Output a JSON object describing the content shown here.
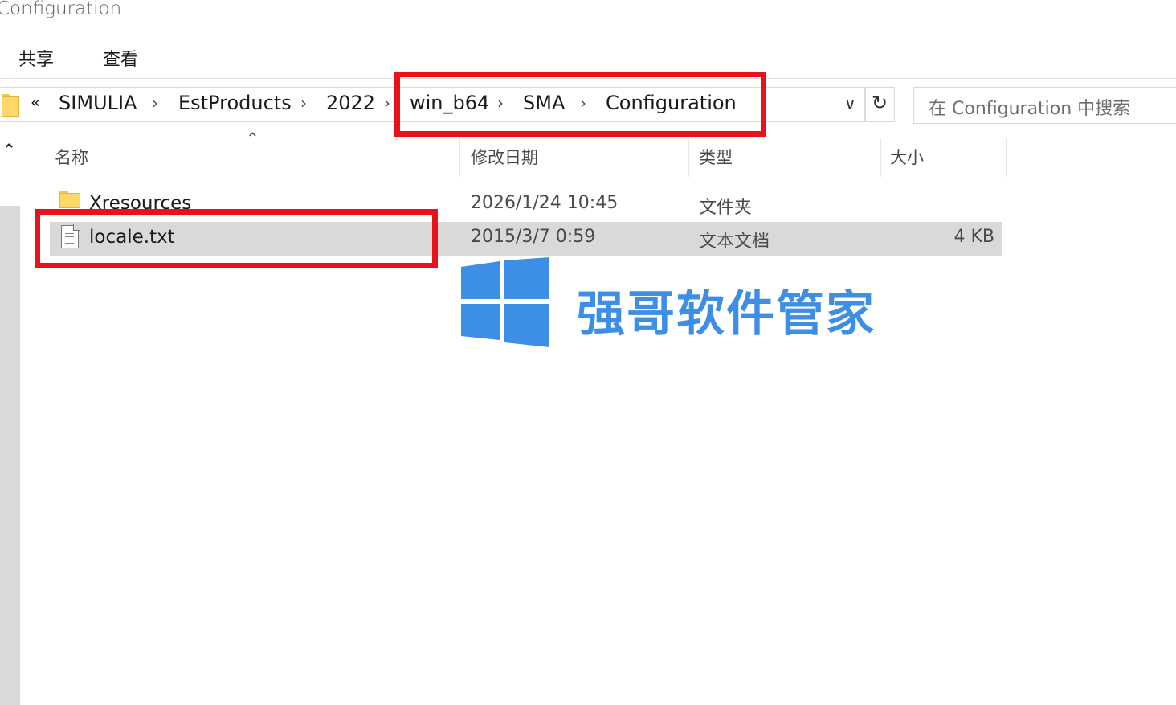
{
  "window": {
    "title": "Configuration"
  },
  "ribbon": {
    "tabs": [
      "共享",
      "查看"
    ]
  },
  "address_bar": {
    "overflow": "«",
    "crumbs": [
      "SIMULIA",
      "EstProducts",
      "2022",
      "win_b64",
      "SMA",
      "Configuration"
    ],
    "separator": "›"
  },
  "search": {
    "placeholder": "在 Configuration 中搜索"
  },
  "columns": {
    "name": "名称",
    "modified": "修改日期",
    "type": "类型",
    "size": "大小"
  },
  "files": [
    {
      "name": "Xresources",
      "modified": "2026/1/24 10:45",
      "type": "文件夹",
      "size": "",
      "icon": "folder-icon"
    },
    {
      "name": "locale.txt",
      "modified": "2015/3/7 0:59",
      "type": "文本文档",
      "size": "4 KB",
      "icon": "text-file-icon",
      "selected": true
    }
  ],
  "watermark": {
    "text": "强哥软件管家"
  },
  "colors": {
    "highlight_box": "#e8131a",
    "selection": "#d9d9d9",
    "watermark": "#3d8ee6",
    "folder": "#ffd866"
  }
}
